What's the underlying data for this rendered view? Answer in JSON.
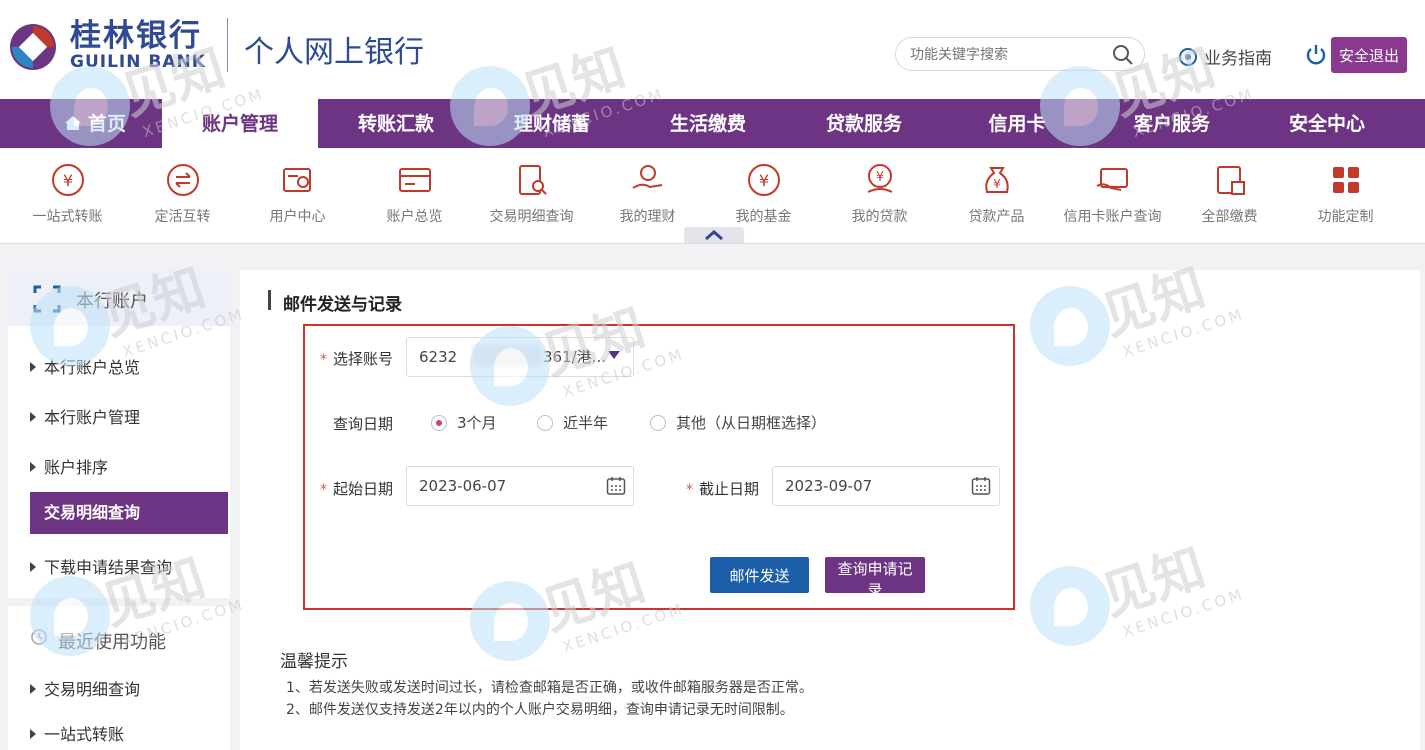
{
  "header": {
    "bank_name_cn": "桂林银行",
    "bank_name_en": "GUILIN BANK",
    "system_title": "个人网上银行",
    "search_placeholder": "功能关键字搜索",
    "guide_label": "业务指南",
    "logout_label": "安全退出",
    "brand_color": "#6c3483"
  },
  "nav": {
    "items": [
      {
        "label": "首页"
      },
      {
        "label": "账户管理"
      },
      {
        "label": "转账汇款"
      },
      {
        "label": "理财储蓄"
      },
      {
        "label": "生活缴费"
      },
      {
        "label": "贷款服务"
      },
      {
        "label": "信用卡"
      },
      {
        "label": "客户服务"
      },
      {
        "label": "安全中心"
      }
    ],
    "active": "账户管理"
  },
  "submenu": {
    "items": [
      {
        "label": "一站式转账",
        "icon": "yuan-cycle-icon"
      },
      {
        "label": "定活互转",
        "icon": "exchange-icon"
      },
      {
        "label": "用户中心",
        "icon": "user-card-icon"
      },
      {
        "label": "账户总览",
        "icon": "card-icon"
      },
      {
        "label": "交易明细查询",
        "icon": "document-search-icon"
      },
      {
        "label": "我的理财",
        "icon": "hand-coin-icon"
      },
      {
        "label": "我的基金",
        "icon": "yuan-check-icon"
      },
      {
        "label": "我的贷款",
        "icon": "yuan-hand-icon"
      },
      {
        "label": "贷款产品",
        "icon": "money-bag-icon"
      },
      {
        "label": "信用卡账户查询",
        "icon": "credit-card-icon"
      },
      {
        "label": "全部缴费",
        "icon": "bill-icon"
      },
      {
        "label": "功能定制",
        "icon": "grid-icon"
      }
    ]
  },
  "sidebar": {
    "section_title": "本行账户",
    "links": [
      {
        "label": "本行账户总览"
      },
      {
        "label": "本行账户管理"
      },
      {
        "label": "账户排序"
      }
    ],
    "active_item": "交易明细查询",
    "after_links": [
      {
        "label": "下载申请结果查询"
      }
    ],
    "recent_title": "最近使用功能",
    "recent_links": [
      {
        "label": "交易明细查询"
      },
      {
        "label": "一站式转账"
      }
    ]
  },
  "main": {
    "title": "邮件发送与记录",
    "form": {
      "required_mark": "*",
      "account_label": "选择账号",
      "account_prefix": "6232",
      "account_suffix": "361/港...",
      "date_range_label": "查询日期",
      "radio_options": [
        {
          "label": "3个月",
          "checked": true
        },
        {
          "label": "近半年",
          "checked": false
        },
        {
          "label": "其他（从日期框选择）",
          "checked": false
        }
      ],
      "start_label": "起始日期",
      "start_value": "2023-06-07",
      "end_label": "截止日期",
      "end_value": "2023-09-07",
      "send_button": "邮件发送",
      "query_button": "查询申请记录"
    },
    "tips": {
      "title": "温馨提示",
      "lines": [
        "1、若发送失败或发送时间过长，请检查邮箱是否正确，或收件邮箱服务器是否正常。",
        "2、邮件发送仅支持发送2年以内的个人账户交易明细，查询申请记录无时间限制。"
      ]
    }
  },
  "watermark": {
    "cn": "见知",
    "en": "XENCIO.COM"
  }
}
